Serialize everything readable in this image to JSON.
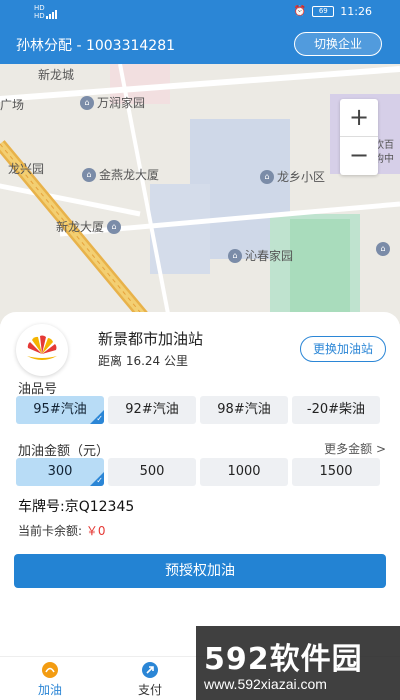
{
  "status_bar": {
    "left_text": "HD",
    "time": "11:26",
    "battery": "69"
  },
  "header": {
    "title": "孙林分配 - 1003314281",
    "switch_label": "切换企业"
  },
  "map": {
    "pois": [
      "新龙城",
      "万润家园",
      "龙兴园",
      "金燕龙大厦",
      "龙乡小区",
      "新龙大厦",
      "沁春家园",
      "广场",
      "饮百",
      "购中"
    ],
    "zoom_in": "+",
    "zoom_out": "−"
  },
  "station": {
    "name": "新景都市加油站",
    "distance": "距离 16.24 公里",
    "change_label": "更换加油站"
  },
  "fuel": {
    "label": "油品号",
    "options": [
      "95#汽油",
      "92#汽油",
      "98#汽油",
      "-20#柴油"
    ],
    "selected_index": 0
  },
  "amount": {
    "label": "加油金额（元）",
    "more_label": "更多金额 >",
    "options": [
      "300",
      "500",
      "1000",
      "1500"
    ],
    "selected_index": 0
  },
  "plate": {
    "text": "车牌号:京Q12345"
  },
  "balance": {
    "label": "当前卡余额:",
    "value": "￥0"
  },
  "action": {
    "primary_label": "预授权加油"
  },
  "tabs": [
    {
      "label": "加油",
      "icon": "fuel-icon",
      "active": true
    },
    {
      "label": "支付",
      "icon": "pay-icon",
      "active": false
    }
  ],
  "watermark": {
    "brand": "592软件园",
    "url": "www.592xiazai.com"
  },
  "colors": {
    "primary": "#2b86d6",
    "selected_bg": "#b8dcf6",
    "balance_red": "#e53935"
  }
}
